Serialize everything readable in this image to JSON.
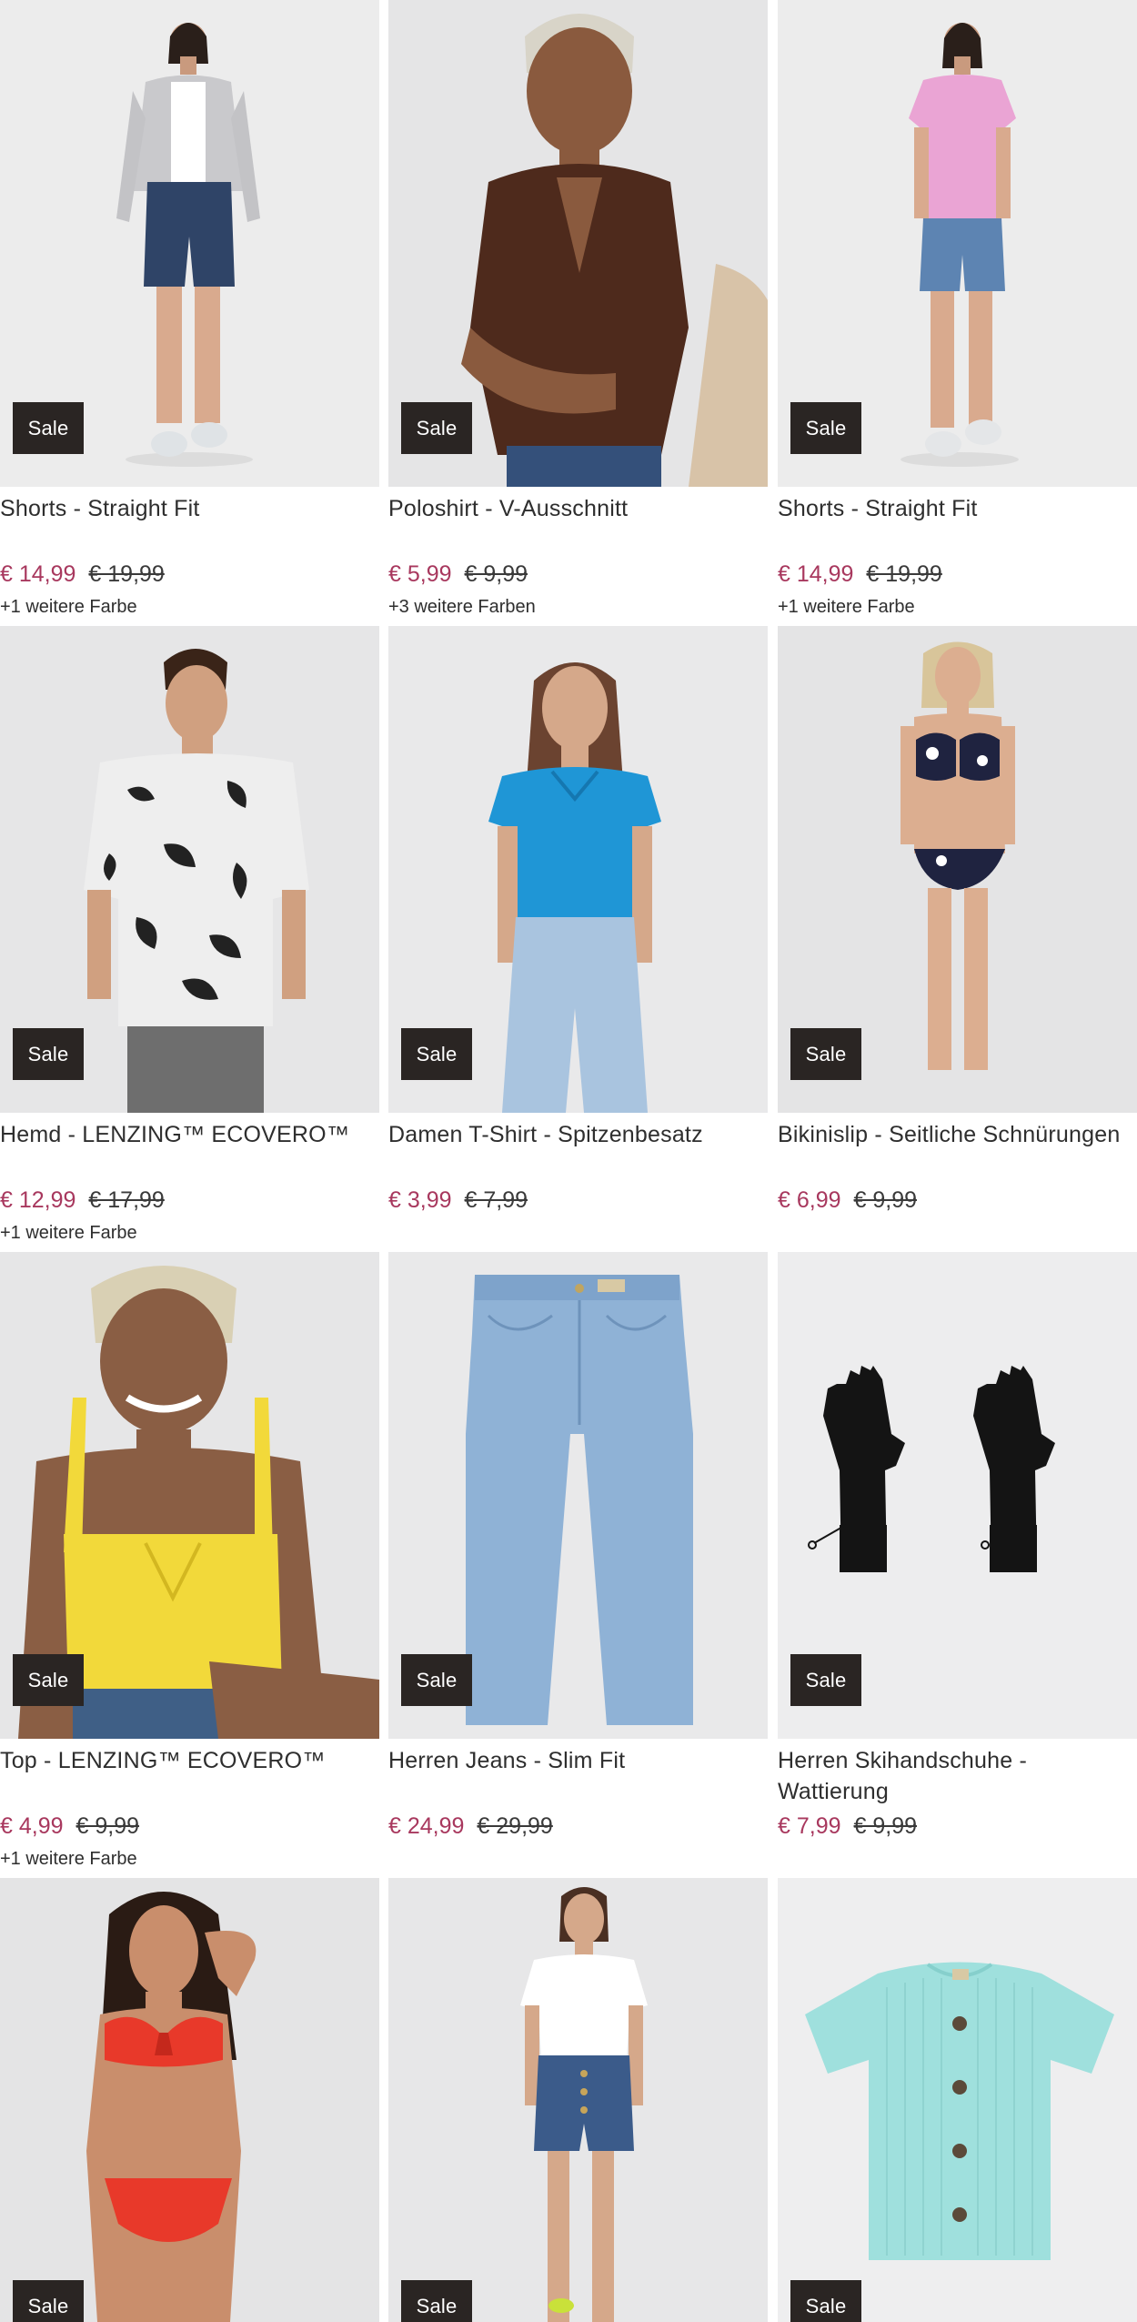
{
  "sale_badge": "Sale",
  "colors": {
    "sale_price": "#a8385e",
    "badge_bg": "#2a2523",
    "photo_bg": "#e9e9ea"
  },
  "products": [
    {
      "title": "Shorts - Straight Fit",
      "price": "€ 14,99",
      "old_price": "€ 19,99",
      "more_colors": "+1 weitere Farbe",
      "image": "woman-grey-cardigan-denim-shorts"
    },
    {
      "title": "Poloshirt - V-Ausschnitt",
      "price": "€ 5,99",
      "old_price": "€ 9,99",
      "more_colors": "+3 weitere Farben",
      "image": "woman-brown-ribbed-polo"
    },
    {
      "title": "Shorts - Straight Fit",
      "price": "€ 14,99",
      "old_price": "€ 19,99",
      "more_colors": "+1 weitere Farbe",
      "image": "woman-pink-tee-denim-shorts"
    },
    {
      "title": "Hemd - LENZING™ ECOVERO™",
      "price": "€ 12,99",
      "old_price": "€ 17,99",
      "more_colors": "+1 weitere Farbe",
      "image": "man-floral-shirt"
    },
    {
      "title": "Damen T-Shirt - Spitzenbesatz",
      "price": "€ 3,99",
      "old_price": "€ 7,99",
      "more_colors": "",
      "image": "woman-blue-lace-tee"
    },
    {
      "title": "Bikinislip - Seitliche Schnürungen",
      "price": "€ 6,99",
      "old_price": "€ 9,99",
      "more_colors": "",
      "image": "woman-floral-bikini"
    },
    {
      "title": "Top - LENZING™ ECOVERO™",
      "price": "€ 4,99",
      "old_price": "€ 9,99",
      "more_colors": "+1 weitere Farbe",
      "image": "woman-yellow-tank-top"
    },
    {
      "title": "Herren Jeans - Slim Fit",
      "price": "€ 24,99",
      "old_price": "€ 29,99",
      "more_colors": "",
      "image": "light-blue-jeans"
    },
    {
      "title": "Herren Skihandschuhe - Wattierung",
      "price": "€ 7,99",
      "old_price": "€ 9,99",
      "more_colors": "",
      "image": "black-gloves"
    },
    {
      "title": "",
      "price": "",
      "old_price": "",
      "more_colors": "",
      "image": "woman-red-bikini"
    },
    {
      "title": "",
      "price": "",
      "old_price": "",
      "more_colors": "",
      "image": "woman-white-tee-denim-shorts"
    },
    {
      "title": "",
      "price": "",
      "old_price": "",
      "more_colors": "",
      "image": "mint-ribbed-button-shirt"
    }
  ]
}
